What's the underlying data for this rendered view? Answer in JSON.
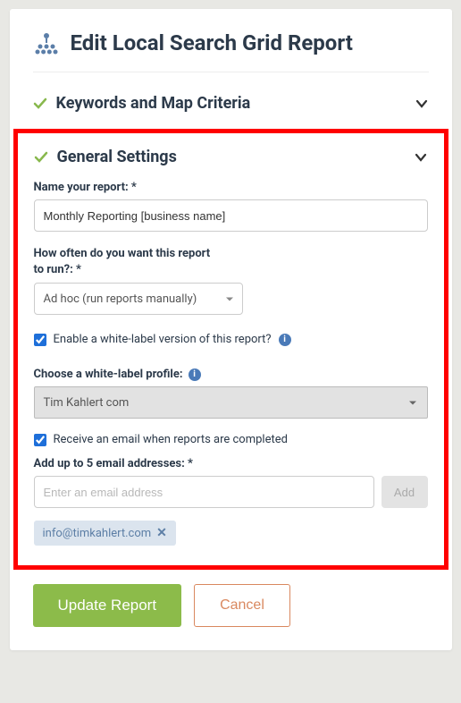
{
  "header": {
    "title": "Edit Local Search Grid Report"
  },
  "sections": {
    "keywords": {
      "title": "Keywords and Map Criteria"
    },
    "general": {
      "title": "General Settings"
    }
  },
  "form": {
    "name_label": "Name your report: *",
    "name_value": "Monthly Reporting [business name]",
    "frequency_label_line1": "How often do you want this report",
    "frequency_label_line2": "to run?: *",
    "frequency_value": "Ad hoc (run reports manually)",
    "whitelabel_checkbox_label": "Enable a white-label version of this report?",
    "whitelabel_profile_label": "Choose a white-label profile:",
    "whitelabel_profile_value": "Tim Kahlert com",
    "email_checkbox_label": "Receive an email when reports are completed",
    "email_addresses_label": "Add up to 5 email addresses: *",
    "email_placeholder": "Enter an email address",
    "add_button": "Add",
    "email_chip": "info@timkahlert.com"
  },
  "footer": {
    "update": "Update Report",
    "cancel": "Cancel"
  }
}
